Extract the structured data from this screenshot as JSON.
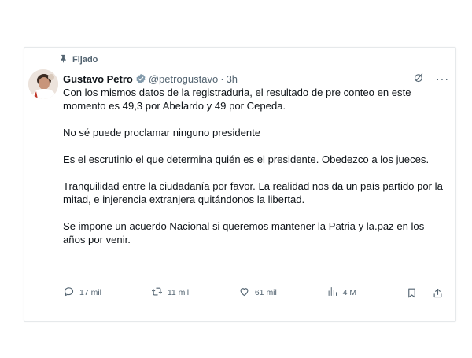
{
  "tweet": {
    "pinned_label": "Fijado",
    "author": {
      "name": "Gustavo Petro",
      "handle": "@petrogustavo",
      "time": "3h"
    },
    "paragraphs": [
      "Con los mismos datos de la registraduria, el resultado de pre conteo en este momento es 49,3 por Abelardo y 49 por Cepeda.",
      "No sé puede proclamar ninguno presidente",
      "Es el escrutinio el que determina quién es el presidente. Obedezco a los jueces.",
      "Tranquilidad entre la ciudadanía por favor. La realidad nos da un país partido por la mitad, e injerencia extranjera quitándonos la libertad.",
      "Se impone un acuerdo Nacional si queremos mantener la Patria y la.paz en los años por venir."
    ],
    "metrics": {
      "replies": "17 mil",
      "retweets": "11 mil",
      "likes": "61 mil",
      "views": "4 M"
    }
  },
  "icons": {
    "pin": "pin-icon",
    "verified": "verified-badge-icon",
    "grok": "grok-icon",
    "more": "more-icon",
    "reply": "reply-icon",
    "retweet": "retweet-icon",
    "like": "like-icon",
    "views": "views-icon",
    "bookmark": "bookmark-icon",
    "share": "share-icon"
  },
  "colors": {
    "text": "#0f1419",
    "secondary": "#536471",
    "verified": "#829aab",
    "border": "#e6e9eb"
  }
}
